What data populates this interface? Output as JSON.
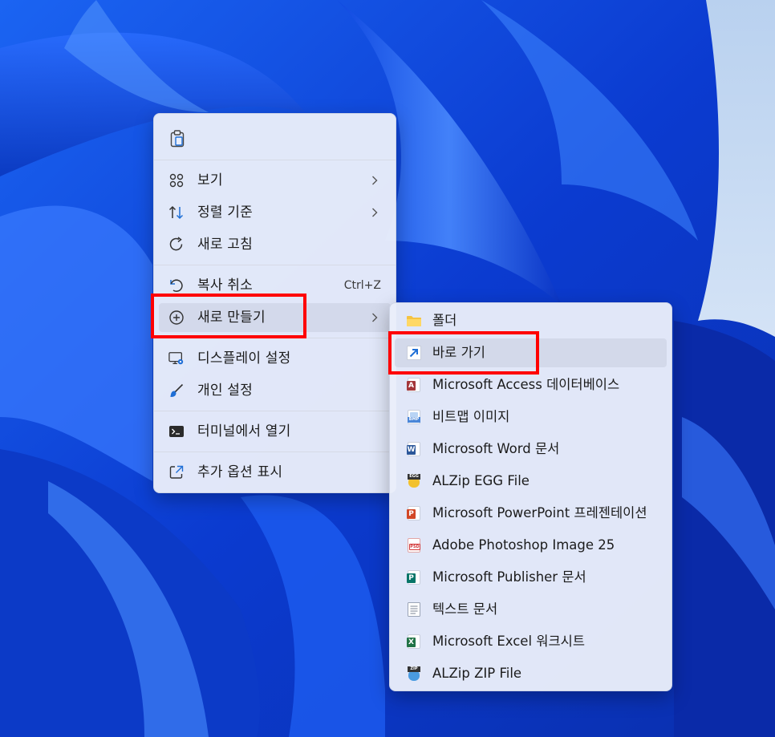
{
  "main_menu": {
    "items": [
      {
        "label": "보기",
        "icon": "grid-view-icon",
        "has_submenu": true
      },
      {
        "label": "정렬 기준",
        "icon": "sort-arrows-icon",
        "has_submenu": true
      },
      {
        "label": "새로 고침",
        "icon": "refresh-icon",
        "has_submenu": false
      },
      {
        "label": "복사 취소",
        "icon": "undo-icon",
        "shortcut": "Ctrl+Z"
      },
      {
        "label": "새로 만들기",
        "icon": "add-circle-icon",
        "has_submenu": true,
        "highlighted": true
      },
      {
        "label": "디스플레이 설정",
        "icon": "display-settings-icon"
      },
      {
        "label": "개인 설정",
        "icon": "brush-icon"
      },
      {
        "label": "터미널에서 열기",
        "icon": "terminal-icon"
      },
      {
        "label": "추가 옵션 표시",
        "icon": "more-options-icon"
      }
    ],
    "toolbar_icon": "paste-icon"
  },
  "sub_menu": {
    "items": [
      {
        "label": "폴더",
        "icon": "folder-icon"
      },
      {
        "label": "바로 가기",
        "icon": "shortcut-arrow-icon",
        "highlighted": true
      },
      {
        "label": "Microsoft Access 데이터베이스",
        "icon": "access-file-icon"
      },
      {
        "label": "비트맵 이미지",
        "icon": "bitmap-file-icon",
        "icon_text": "BMP"
      },
      {
        "label": "Microsoft Word 문서",
        "icon": "word-file-icon",
        "icon_text": "W"
      },
      {
        "label": "ALZip EGG File",
        "icon": "egg-file-icon",
        "icon_text": "EGG"
      },
      {
        "label": "Microsoft PowerPoint 프레젠테이션",
        "icon": "powerpoint-file-icon",
        "icon_text": "P"
      },
      {
        "label": "Adobe Photoshop Image 25",
        "icon": "psd-file-icon",
        "icon_text": "PSD"
      },
      {
        "label": "Microsoft Publisher 문서",
        "icon": "publisher-file-icon",
        "icon_text": "P"
      },
      {
        "label": "텍스트 문서",
        "icon": "text-file-icon"
      },
      {
        "label": "Microsoft Excel 워크시트",
        "icon": "excel-file-icon",
        "icon_text": "X"
      },
      {
        "label": "ALZip ZIP File",
        "icon": "zip-file-icon",
        "icon_text": "ZIP"
      }
    ]
  },
  "colors": {
    "highlight_box": "#ff0000",
    "menu_bg": "#eaeefa",
    "wallpaper": "#0a3fd8"
  }
}
